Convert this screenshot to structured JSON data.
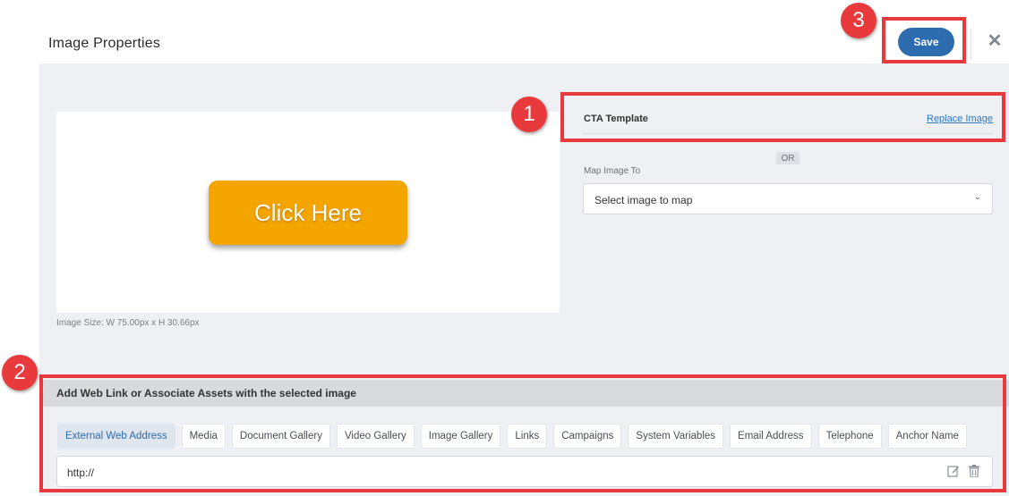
{
  "header": {
    "title": "Image Properties",
    "save_label": "Save"
  },
  "preview": {
    "cta_text": "Click Here",
    "image_size": "Image Size: W 75.00px x H 30.66px"
  },
  "template": {
    "name": "CTA Template",
    "replace_label": "Replace Image",
    "or_label": "OR"
  },
  "map": {
    "label": "Map Image To",
    "selected": "Select image to map"
  },
  "associate": {
    "title": "Add Web Link or Associate Assets with the selected image",
    "tabs": [
      {
        "label": "External Web Address"
      },
      {
        "label": "Media"
      },
      {
        "label": "Document Gallery"
      },
      {
        "label": "Video Gallery"
      },
      {
        "label": "Image Gallery"
      },
      {
        "label": "Links"
      },
      {
        "label": "Campaigns"
      },
      {
        "label": "System Variables"
      },
      {
        "label": "Email Address"
      },
      {
        "label": "Telephone"
      },
      {
        "label": "Anchor Name"
      }
    ],
    "active_tab": "External Web Address",
    "url_value": "http://"
  },
  "annotations": {
    "markers": [
      "1",
      "2",
      "3"
    ],
    "color": "#e8393c"
  },
  "colors": {
    "accent": "#2d6cae",
    "cta": "#f5a500"
  }
}
